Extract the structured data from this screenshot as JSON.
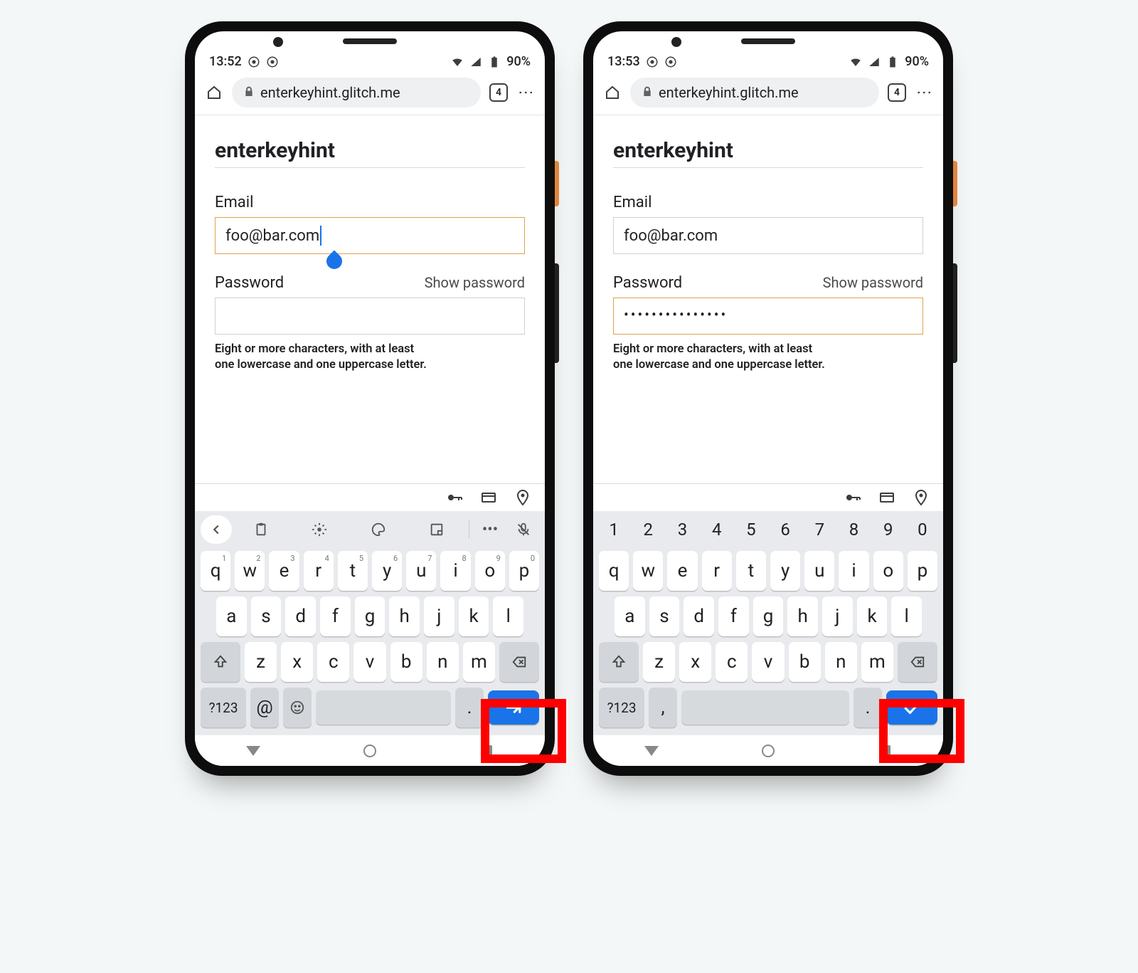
{
  "phones": [
    {
      "status": {
        "time": "13:52",
        "battery": "90%",
        "icons": [
          "chrome",
          "chrome2",
          "wifi",
          "signal",
          "battery"
        ]
      },
      "chrome": {
        "url": "enterkeyhint.glitch.me",
        "tab_count": "4"
      },
      "page": {
        "heading": "enterkeyhint",
        "email_label": "Email",
        "email_value": "foo@bar.com",
        "email_active": true,
        "password_label": "Password",
        "show_password": "Show password",
        "password_value": "",
        "password_active": false,
        "hint_line1": "Eight or more characters, with at least",
        "hint_line2": "one lowercase and one uppercase letter."
      },
      "keyboard": {
        "mode": "email",
        "row1": [
          {
            "k": "q",
            "s": "1"
          },
          {
            "k": "w",
            "s": "2"
          },
          {
            "k": "e",
            "s": "3"
          },
          {
            "k": "r",
            "s": "4"
          },
          {
            "k": "t",
            "s": "5"
          },
          {
            "k": "y",
            "s": "6"
          },
          {
            "k": "u",
            "s": "7"
          },
          {
            "k": "i",
            "s": "8"
          },
          {
            "k": "o",
            "s": "9"
          },
          {
            "k": "p",
            "s": "0"
          }
        ],
        "row2": [
          "a",
          "s",
          "d",
          "f",
          "g",
          "h",
          "j",
          "k",
          "l"
        ],
        "row3": [
          "z",
          "x",
          "c",
          "v",
          "b",
          "n",
          "m"
        ],
        "sym": "?123",
        "at": "@",
        "emoji": "☺",
        "dot": ".",
        "enter": "next"
      }
    },
    {
      "status": {
        "time": "13:53",
        "battery": "90%",
        "icons": [
          "chrome",
          "chrome2",
          "wifi",
          "signal",
          "battery"
        ]
      },
      "chrome": {
        "url": "enterkeyhint.glitch.me",
        "tab_count": "4"
      },
      "page": {
        "heading": "enterkeyhint",
        "email_label": "Email",
        "email_value": "foo@bar.com",
        "email_active": false,
        "password_label": "Password",
        "show_password": "Show password",
        "password_value": "•••••••••••••••",
        "password_active": true,
        "hint_line1": "Eight or more characters, with at least",
        "hint_line2": "one lowercase and one uppercase letter."
      },
      "keyboard": {
        "mode": "password",
        "num_row": [
          "1",
          "2",
          "3",
          "4",
          "5",
          "6",
          "7",
          "8",
          "9",
          "0"
        ],
        "row1": [
          {
            "k": "q"
          },
          {
            "k": "w"
          },
          {
            "k": "e"
          },
          {
            "k": "r"
          },
          {
            "k": "t"
          },
          {
            "k": "y"
          },
          {
            "k": "u"
          },
          {
            "k": "i"
          },
          {
            "k": "o"
          },
          {
            "k": "p"
          }
        ],
        "row2": [
          "a",
          "s",
          "d",
          "f",
          "g",
          "h",
          "j",
          "k",
          "l"
        ],
        "row3": [
          "z",
          "x",
          "c",
          "v",
          "b",
          "n",
          "m"
        ],
        "sym": "?123",
        "comma": ",",
        "dot": ".",
        "enter": "done"
      }
    }
  ]
}
